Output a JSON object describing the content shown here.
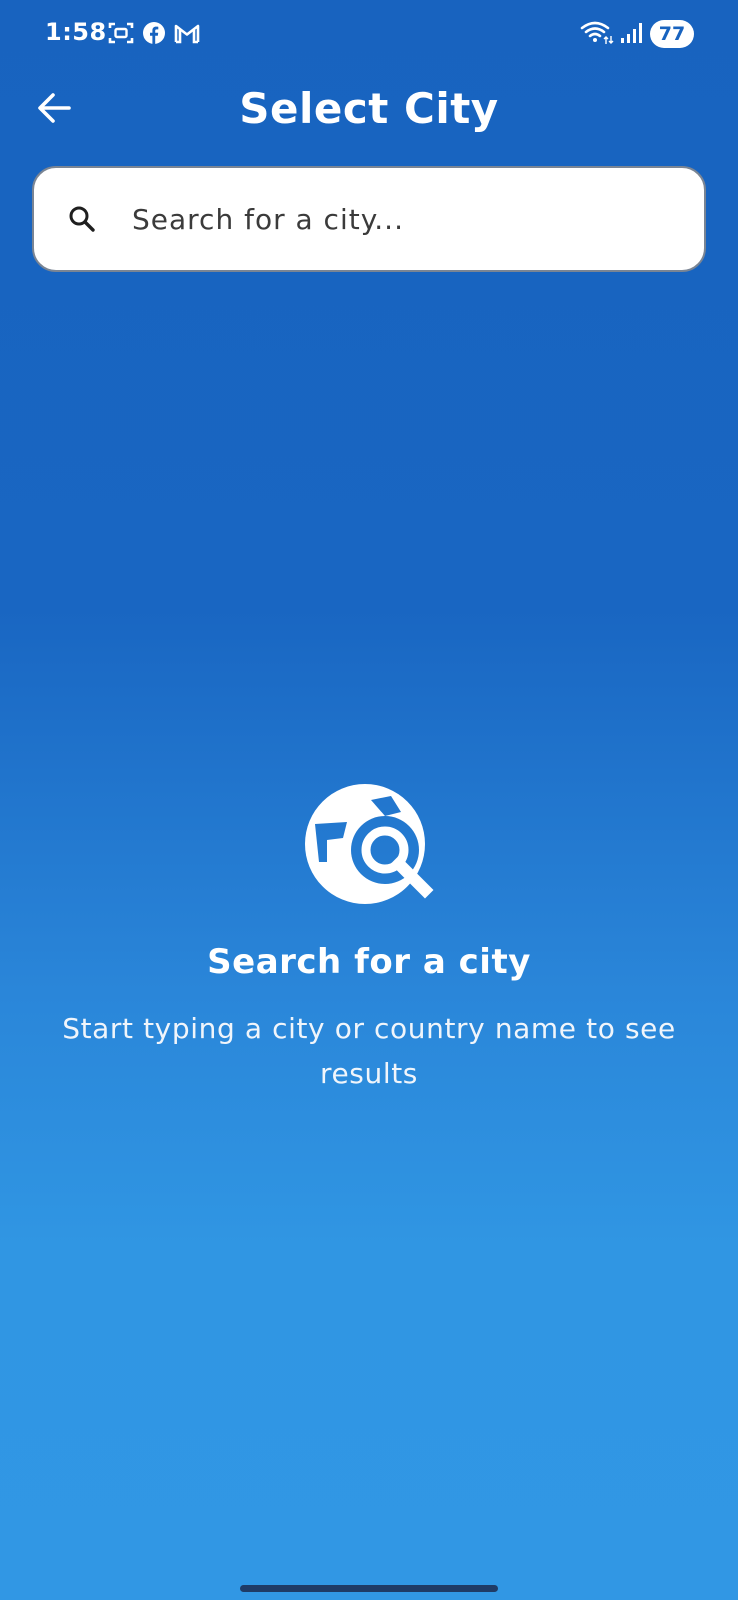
{
  "status_bar": {
    "time": "1:58",
    "left_icons": [
      "screenshot-icon",
      "facebook-icon",
      "gmail-icon"
    ],
    "right_icons": [
      "wifi-icon",
      "signal-icon"
    ],
    "battery": "77"
  },
  "header": {
    "title": "Select City",
    "back_icon": "arrow-left-icon"
  },
  "search": {
    "placeholder": "Search for a city...",
    "value": "",
    "icon": "search-icon"
  },
  "empty_state": {
    "icon": "travel-explore-icon",
    "title": "Search for a city",
    "subtitle": "Start typing a city or country name to see results"
  },
  "colors": {
    "background_top": "#1863bf",
    "background_bottom": "#3197e4",
    "search_background": "#ffffff",
    "text_primary": "#ffffff"
  }
}
